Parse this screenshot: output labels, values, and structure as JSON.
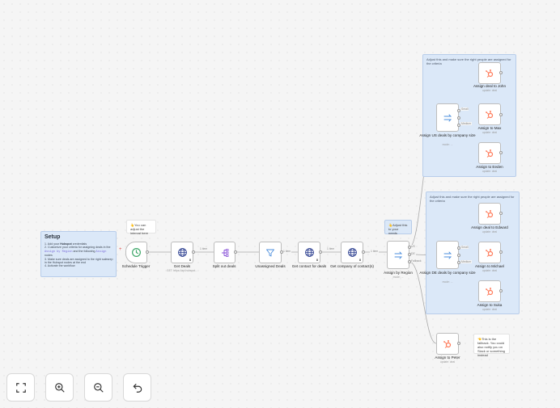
{
  "setup": {
    "title": "Setup",
    "steps": [
      {
        "pre": "1. Add your ",
        "bold": "Hubspot",
        "post": " credentials"
      },
      {
        "pre": "2. Customize your criteria for assigning deals in the ",
        "code": "Assign by Region",
        "post": " and the following ",
        "code2": "Assign",
        "post2": " nodes"
      },
      {
        "pre": "3. Make sure deals are assigned to the right salesrep in the Hubspot nodes at the end"
      },
      {
        "pre": "4. Activate the workflow"
      }
    ]
  },
  "notes": {
    "interval": "👆You can adjust the interval here",
    "region": "👆Adjust this to your needs",
    "fallback": "👈This is the fallback. You could also notify you on Slack or something instead",
    "us_group": "Adjust this and make sure the right people are assigned for the criteria",
    "de_group": "Adjust this and make sure the right people are assigned for the criteria"
  },
  "nodes": {
    "schedule": {
      "label": "Schedule Trigger"
    },
    "get_deals": {
      "label": "Get Deals",
      "sub": "GET: https://api.hubspot...",
      "badge": "8"
    },
    "split": {
      "label": "Split out deals"
    },
    "unassigned": {
      "label": "Unassigned Deals"
    },
    "get_contact": {
      "label": "Get contact for deals",
      "badge": "8"
    },
    "get_company": {
      "label": "Get company of contact(s)",
      "badge": "8"
    },
    "region": {
      "label": "Assign by Region",
      "sub": "mode: ..."
    },
    "us": {
      "label": "Assign US deals by company size",
      "sub": "mode: ..."
    },
    "de": {
      "label": "Assign DE deals by company size",
      "sub": "mode: ..."
    },
    "john": {
      "label": "Assign deal to John",
      "sub": "update: deal"
    },
    "max": {
      "label": "Assign to Max",
      "sub": "update: deal"
    },
    "eeden": {
      "label": "Assign to Eeden",
      "sub": "update: deal"
    },
    "edward": {
      "label": "Assign deal to Edward",
      "sub": "update: deal"
    },
    "michael": {
      "label": "Assign to Michael",
      "sub": "update: deal"
    },
    "suka": {
      "label": "Assign to Suka",
      "sub": "update: deal"
    },
    "peter": {
      "label": "Assign to Peter",
      "sub": "update: deal"
    }
  },
  "edge_labels": {
    "e1": "1 item",
    "e2": "1 item",
    "e3": "1 item",
    "e4": "1 item",
    "us_out": "US",
    "de_out": "DE",
    "fallback_out": "Fallback",
    "us_a": "Small",
    "us_b": "Medium",
    "de_a": "Small",
    "de_b": "Medium"
  },
  "controls": {
    "fit": "fit-view-icon",
    "zoom_in": "zoom-in-icon",
    "zoom_out": "zoom-out-icon",
    "undo": "undo-icon"
  },
  "colors": {
    "hubspot": "#ff7a59",
    "http": "#2a3d8f",
    "trigger": "#40a86b",
    "split": "#8a54d8",
    "filter": "#4d8fdd",
    "switch": "#4d8fdd"
  }
}
